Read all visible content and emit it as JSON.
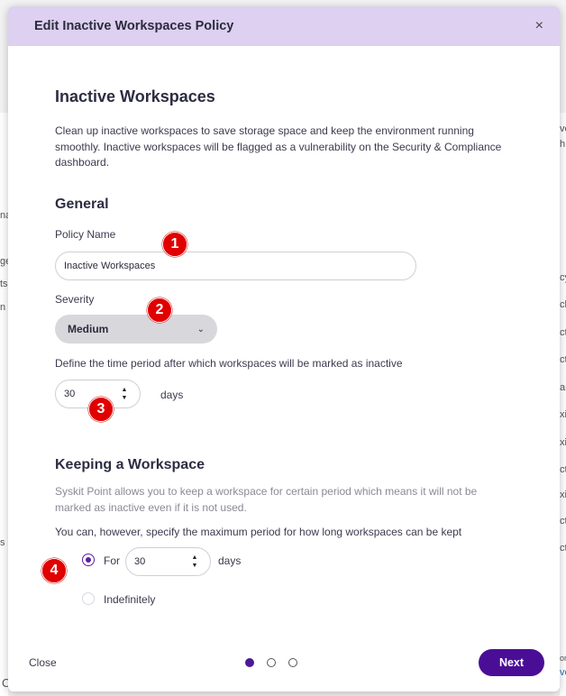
{
  "background": {
    "left_fragments": [
      "na",
      "ge",
      "ts",
      "n",
      "s",
      "C"
    ],
    "right_fragments": [
      "ve",
      "h",
      "cy",
      "ck",
      "ct",
      "ct",
      "ar",
      "xi",
      "xi",
      "ct",
      "xi",
      "ct",
      "ct",
      "or",
      "ve"
    ]
  },
  "modal": {
    "title": "Edit Inactive Workspaces Policy",
    "close_icon": "×"
  },
  "intro": {
    "heading": "Inactive Workspaces",
    "description": "Clean up inactive workspaces to save storage space and keep the environment running smoothly. Inactive workspaces will be flagged as a vulnerability on the Security & Compliance dashboard."
  },
  "general": {
    "heading": "General",
    "policy_name_label": "Policy Name",
    "policy_name_value": "Inactive Workspaces",
    "severity_label": "Severity",
    "severity_value": "Medium",
    "period_label": "Define the time period after which workspaces will be marked as inactive",
    "period_value": "30",
    "period_unit": "days"
  },
  "keeping": {
    "heading": "Keeping a Workspace",
    "note": "Syskit Point allows you to keep a workspace for certain period which means it will not be marked as inactive even if it is not used.",
    "max_label": "You can, however, specify the maximum period for how long workspaces can be kept",
    "for_label": "For",
    "for_value": "30",
    "for_unit": "days",
    "for_checked": true,
    "indefinitely_label": "Indefinitely",
    "indefinitely_checked": false
  },
  "badges": [
    "1",
    "2",
    "3",
    "4"
  ],
  "footer": {
    "close_label": "Close",
    "step_current": 1,
    "step_total": 3,
    "next_label": "Next"
  },
  "colors": {
    "header_bg": "#ddd0f0",
    "accent": "#4a0e96",
    "badge": "#e00000"
  }
}
